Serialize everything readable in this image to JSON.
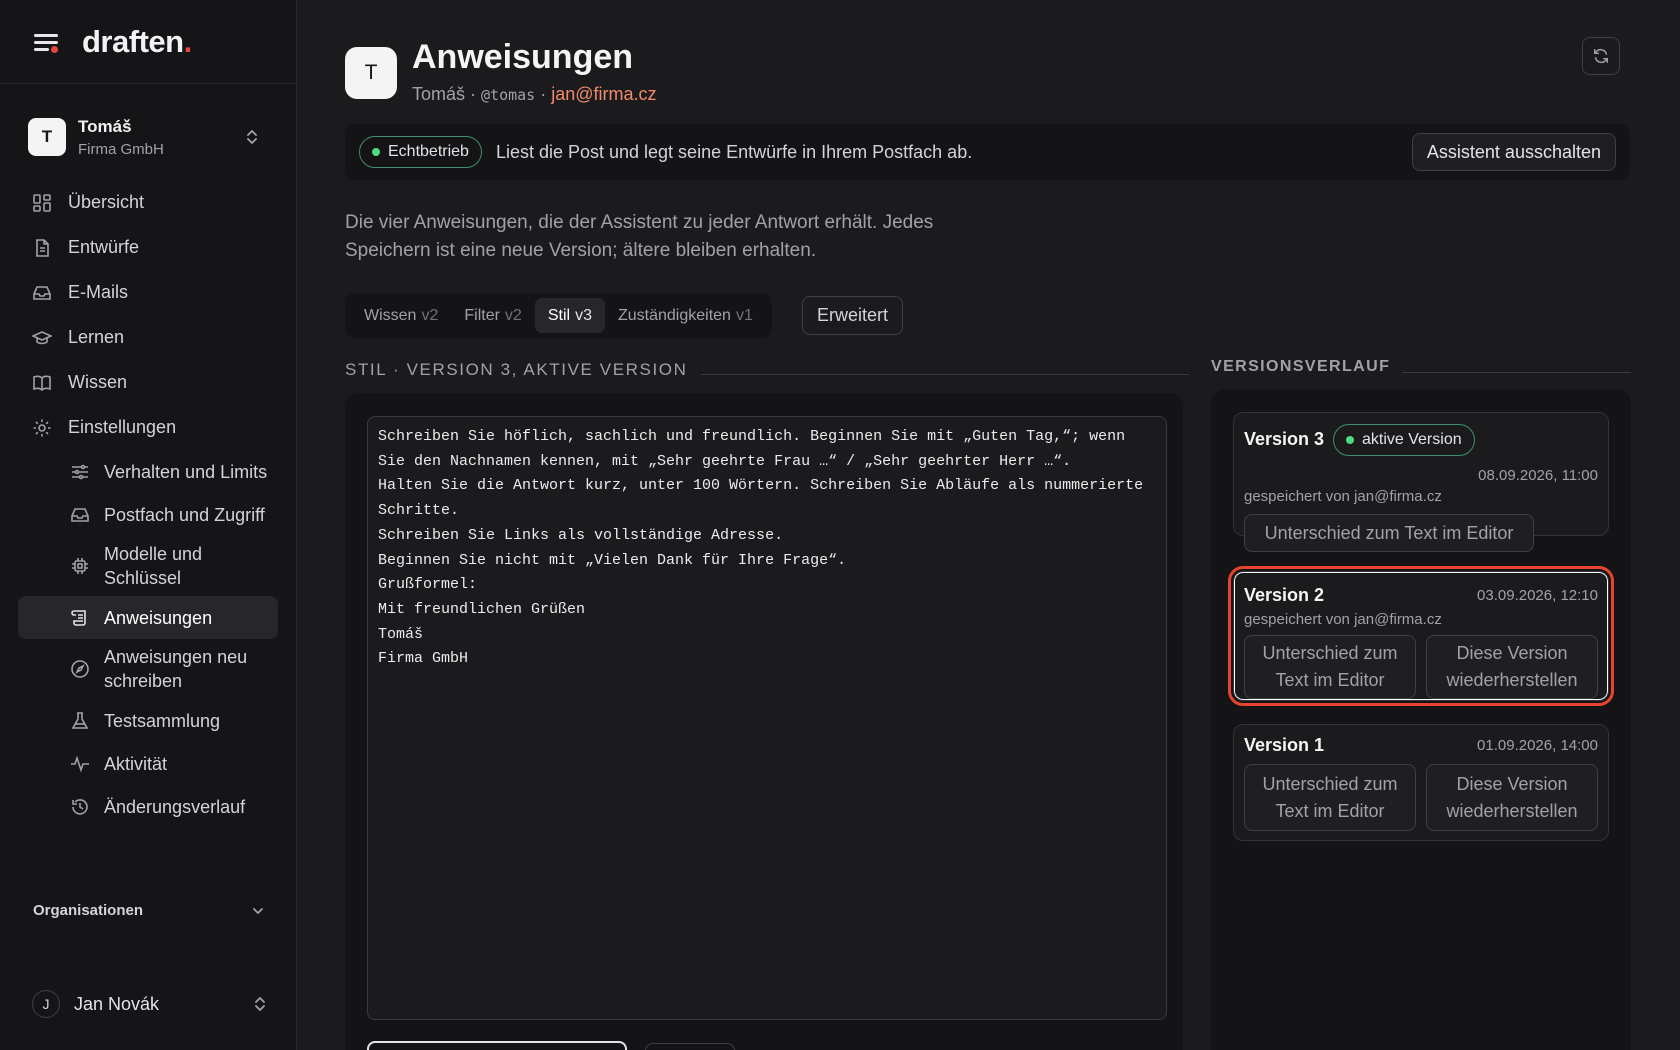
{
  "app": {
    "logo": "draften",
    "logo_dot": "."
  },
  "workspace": {
    "initial": "T",
    "name": "Tomáš",
    "org": "Firma GmbH"
  },
  "nav": {
    "overview": "Übersicht",
    "drafts": "Entwürfe",
    "emails": "E-Mails",
    "learn": "Lernen",
    "knowledge": "Wissen",
    "settings": "Einstellungen",
    "sub": {
      "behavior": "Verhalten und Limits",
      "mailbox": "Postfach und Zugriff",
      "models": "Modelle und Schlüssel",
      "instructions": "Anweisungen",
      "rewrite": "Anweisungen neu schreiben",
      "tests": "Testsammlung",
      "activity": "Aktivität",
      "changelog": "Änderungsverlauf"
    },
    "organisations": "Organisationen"
  },
  "user": {
    "initial": "J",
    "name": "Jan Novák"
  },
  "header": {
    "avatar": "T",
    "title": "Anweisungen",
    "name": "Tomáš",
    "sep1": " · ",
    "handle": "@tomas",
    "sep2": " · ",
    "email": "jan@firma.cz"
  },
  "status": {
    "badge": "Echtbetrieb",
    "text": "Liest die Post und legt seine Entwürfe in Ihrem Postfach ab.",
    "button": "Assistent ausschalten"
  },
  "intro": "Die vier Anweisungen, die der Assistent zu jeder Antwort erhält. Jedes Speichern ist eine neue Version; ältere bleiben erhalten.",
  "tabs": [
    {
      "label": "Wissen",
      "version": "v2"
    },
    {
      "label": "Filter",
      "version": "v2"
    },
    {
      "label": "Stil",
      "version": "v3"
    },
    {
      "label": "Zuständigkeiten",
      "version": "v1"
    }
  ],
  "advanced": "Erweitert",
  "editor": {
    "heading": "STIL · VERSION 3, AKTIVE VERSION",
    "text": "Schreiben Sie höflich, sachlich und freundlich. Beginnen Sie mit „Guten Tag,“; wenn Sie den Nachnamen kennen, mit „Sehr geehrte Frau …“ / „Sehr geehrter Herr …“.\nHalten Sie die Antwort kurz, unter 100 Wörtern. Schreiben Sie Abläufe als nummerierte Schritte.\nSchreiben Sie Links als vollständige Adresse.\nBeginnen Sie nicht mit „Vielen Dank für Ihre Frage“.\nGrußformel:\nMit freundlichen Grüßen\nTomáš\nFirma GmbH"
  },
  "history": {
    "heading": "VERSIONSVERLAUF",
    "versions": [
      {
        "title": "Version 3",
        "badge": "aktive Version",
        "date": "08.09.2026, 11:00",
        "by": "gespeichert von jan@firma.cz",
        "diff": "Unterschied zum Text im Editor"
      },
      {
        "title": "Version 2",
        "date": "03.09.2026, 12:10",
        "by": "gespeichert von jan@firma.cz",
        "diff": "Unterschied zum Text im Editor",
        "restore": "Diese Version wiederherstellen"
      },
      {
        "title": "Version 1",
        "date": "01.09.2026, 14:00",
        "diff": "Unterschied zum Text im Editor",
        "restore": "Diese Version wiederherstellen"
      }
    ]
  },
  "colors": {
    "accent": "#e5483a",
    "email": "#f08a6a",
    "live": "#4ade80",
    "highlight": "#e8432f"
  }
}
